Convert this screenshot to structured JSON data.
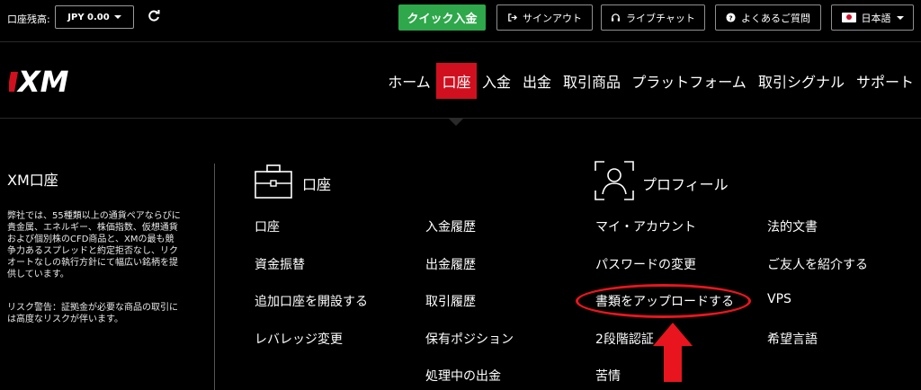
{
  "topbar": {
    "balance_label": "口座残高:",
    "balance_value": "JPY 0.00",
    "quick_deposit": "クイック入金",
    "sign_out": "サインアウト",
    "live_chat": "ライブチャット",
    "faq": "よくあるご質問",
    "language": "日本語"
  },
  "logo": {
    "text": "XM",
    "accent_color": "#d1101f"
  },
  "nav": {
    "items": [
      "ホーム",
      "口座",
      "入金",
      "出金",
      "取引商品",
      "プラットフォーム",
      "取引シグナル",
      "サポート"
    ],
    "active": "口座",
    "active_color": "#d1101f"
  },
  "account_panel": {
    "title": "XM口座",
    "description": "弊社では、55種類以上の通貨ペアならびに貴金属、エネルギー、株価指数、仮想通貨および個別株のCFD商品と、XMの最も競争力あるスプレッドと約定拒否なし、リクオートなしの執行方針にて幅広い銘柄を提供しています。",
    "warning": "リスク警告：証拠金が必要な商品の取引には高度なリスクが伴います。"
  },
  "menu": {
    "account_heading": "口座",
    "profile_heading": "プロフィール",
    "col1": [
      "口座",
      "資金振替",
      "追加口座を開設する",
      "レバレッジ変更"
    ],
    "col2": [
      "入金履歴",
      "出金履歴",
      "取引履歴",
      "保有ポジション",
      "処理中の出金"
    ],
    "col3": [
      "マイ・アカウント",
      "パスワードの変更",
      "書類をアップロードする",
      "2段階認証",
      "苦情"
    ],
    "col4": [
      "法的文書",
      "ご友人を紹介する",
      "VPS",
      "希望言語"
    ]
  },
  "colors": {
    "quick_deposit_bg": "#2ea84a",
    "annotation_red": "#e8151e"
  }
}
